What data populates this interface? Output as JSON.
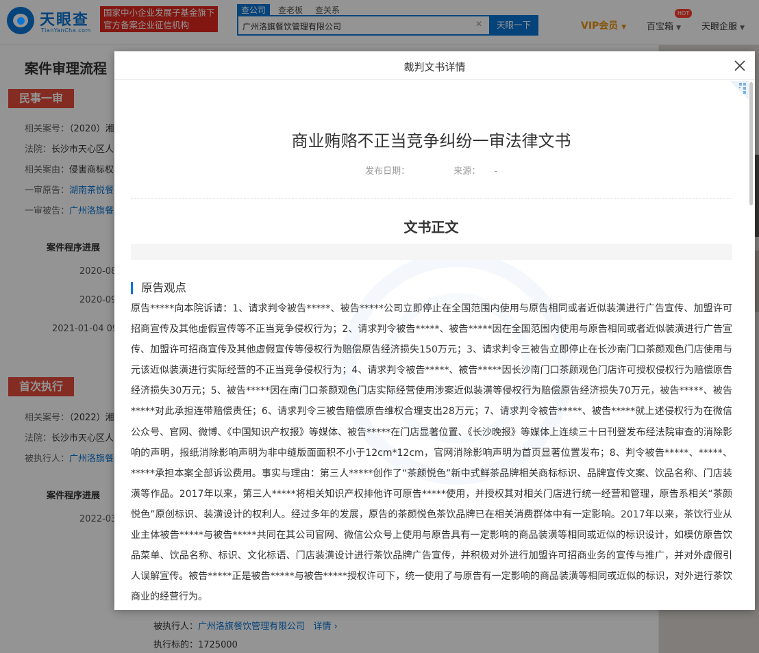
{
  "header": {
    "logo_name": "天眼查",
    "logo_domain": "TianYanCha.com",
    "slogan_line1": "国家中小企业发展子基金旗下",
    "slogan_line2": "官方备案企业征信机构",
    "search_tabs": [
      "查公司",
      "查老板",
      "查关系"
    ],
    "search_value": "广州洛旗餐饮管理有限公司",
    "search_button": "天眼一下",
    "vip_label": "VIP会员",
    "baibao_label": "百宝箱",
    "hot_badge": "HOT",
    "qiye_label": "天眼企服",
    "accent_color": "#0a74d4"
  },
  "background": {
    "page_title": "案件审理流程",
    "stage1": {
      "tag": "民事一审",
      "fields": [
        {
          "label": "相关案号：",
          "value": "（2020）湘",
          "link": false
        },
        {
          "label": "法院：",
          "value": "长沙市天心区人",
          "link": false
        },
        {
          "label": "相关案由：",
          "value": "侵害商标权",
          "link": false
        },
        {
          "label": "一审原告：",
          "value": "湖南茶悦餐",
          "link": true
        },
        {
          "label": "一审被告：",
          "value": "广州洛旗餐",
          "link": true
        }
      ],
      "progress_title": "案件程序进展",
      "dates": [
        "2020-08",
        "2020-09",
        "2021-01-04 09"
      ]
    },
    "stage2": {
      "tag": "首次执行",
      "fields": [
        {
          "label": "相关案号：",
          "value": "（2022）湘",
          "link": false
        },
        {
          "label": "法院：",
          "value": "长沙市天心区人",
          "link": false
        },
        {
          "label": "被执行人：",
          "value": "广州洛旗餐",
          "link": true
        }
      ],
      "progress_title": "案件程序进展",
      "dates": [
        "2022-03"
      ]
    },
    "bottom": {
      "executed_label": "被执行人：",
      "executed_value": "广州洛旗餐饮管理有限公司",
      "detail_link": "详情 ›",
      "target_label": "执行标的：",
      "target_value": "1725000"
    }
  },
  "modal": {
    "title": "裁判文书详情",
    "doc_title": "商业贿赂不正当竞争纠纷一审法律文书",
    "publish_date_label": "发布日期：",
    "publish_date_value": "",
    "source_label": "来源：",
    "source_value": "-",
    "body_heading": "文书正文",
    "section_title": "原告观点",
    "section_text": "原告*****向本院诉请：1、请求判令被告*****、被告*****公司立即停止在全国范围内使用与原告相同或者近似装潢进行广告宣传、加盟许可招商宣传及其他虚假宣传等不正当竞争侵权行为；2、请求判令被告*****、被告*****因在全国范围内使用与原告相同或者近似装潢进行广告宣传、加盟许可招商宣传及其他虚假宣传等侵权行为赔偿原告经济损失150万元；3、请求判令三被告立即停止在长沙南门口茶颜观色门店使用与元该近似装潢进行实际经营的不正当竞争侵权行为；4、请求判令被告*****、被告*****因长沙南门口茶颜观色门店许可授权侵权行为赔偿原告经济损失30万元；5、被告*****因在南门口茶颜观色门店实际经营使用涉案近似装潢等侵权行为赔偿原告经济损失70万元，被告*****、被告*****对此承担连带赔偿责任；6、请求判令三被告赔偿原告维权合理支出28万元；7、请求判令被告*****、被告*****就上述侵权行为在微信公众号、官网、微博、《中国知识产权报》等媒体、被告*****在门店显著位置、《长沙晚报》等媒体上连续三十日刊登发布经法院审查的消除影响的声明，报纸消除影响声明为非中缝版面面积不小于12cm*12cm，官网消除影响声明为首页显著位置发布；8、判令被告*****、*****、*****承担本案全部诉讼费用。事实与理由：第三人*****创作了“茶颜悦色”新中式鲜茶品牌相关商标标识、品牌宣传文案、饮品名称、门店装潢等作品。2017年以来，第三人*****将相关知识产权排他许可原告*****使用，并授权其对相关门店进行统一经营和管理，原告系相关“茶颜悦色”原创标识、装潢设计的权利人。经过多年的发展，原告的茶颜悦色茶饮品牌已在相关消费群体中有一定影响。2017年以来，茶饮行业从业主体被告*****与被告*****共同在其公司官网、微信公众号上使用与原告具有一定影响的商品装潢等相同或近似的标识设计，如模仿原告饮品菜单、饮品名称、标识、文化标语、门店装潢设计进行茶饮品牌广告宣传，并积极对外进行加盟许可招商业务的宣传与推广，并对外虚假引人误解宣传。被告*****正是被告*****与被告*****授权许可下，统一使用了与原告有一定影响的商品装潢等相同或近似的标识，对外进行茶饮商业的经营行为。"
  },
  "icons": {
    "close": "close-icon",
    "clear": "clear-icon",
    "dropdown": "caret-down-icon",
    "logo": "tianyancha-logo-icon",
    "qr": "qr-corner-icon"
  }
}
